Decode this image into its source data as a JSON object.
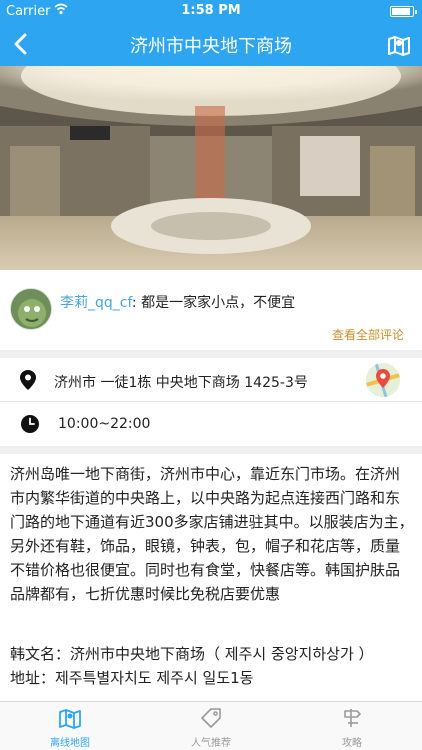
{
  "status_bar": {
    "carrier": "Carrier",
    "time": "1:58 PM"
  },
  "nav": {
    "title": "济州市中央地下商场",
    "back_icon": "chevron-left-icon",
    "map_icon": "map-icon"
  },
  "hero_image": {
    "description": ""
  },
  "comment": {
    "username": "李莉_qq_cf",
    "text": ": 都是一家家小点，不便宜",
    "view_all": "查看全部评论"
  },
  "address": {
    "text": "济州市 一徒1栋 中央地下商场 1425-3号"
  },
  "hours": {
    "text": "10:00~22:00"
  },
  "description": "济州岛唯一地下商街，济州市中心，靠近东门市场。在济州市内繁华街道的中央路上，以中央路为起点连接西门路和东门路的地下通道有近300多家店铺进驻其中。以服装店为主，另外还有鞋，饰品，眼镜，钟表，包，帽子和花店等，质量不错价格也很便宜。同时也有食堂，快餐店等。韩国护肤品品牌都有，七折优惠时候比免税店要优惠",
  "korean_name": "韩文名：济州市中央地下商场（ 제주시 중앙지하상가 ）",
  "korean_address": "地址：제주특별자치도 제주시 일도1동",
  "tabbar": {
    "tabs": [
      {
        "label": "离线地图",
        "active": true
      },
      {
        "label": "人气推荐",
        "active": false
      },
      {
        "label": "攻略",
        "active": false
      }
    ]
  },
  "colors": {
    "accent": "#2ea5f0",
    "link": "#4aa3df",
    "view_all": "#c98f2b"
  }
}
